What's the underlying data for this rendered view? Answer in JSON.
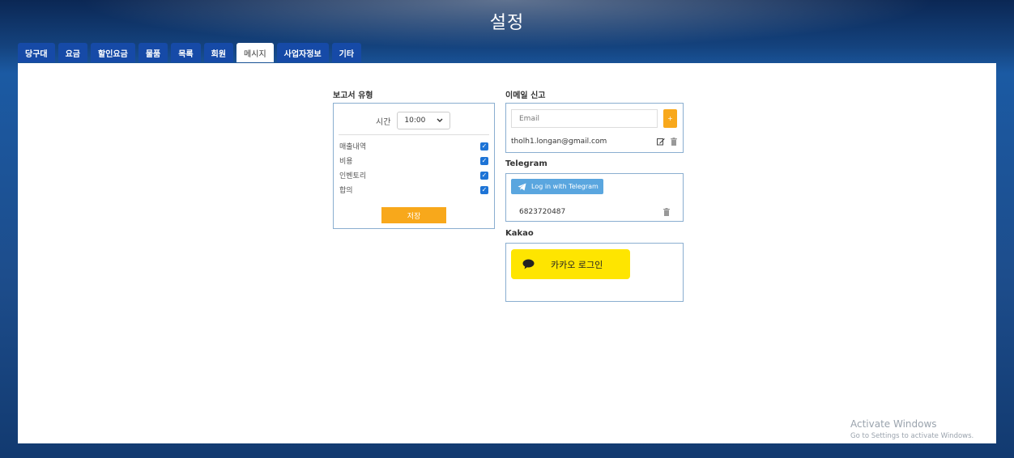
{
  "window": {
    "title": "설정"
  },
  "tabs": [
    {
      "label": "당구대",
      "active": false
    },
    {
      "label": "요금",
      "active": false
    },
    {
      "label": "할인요금",
      "active": false
    },
    {
      "label": "물품",
      "active": false
    },
    {
      "label": "목록",
      "active": false
    },
    {
      "label": "회원",
      "active": false
    },
    {
      "label": "메시지",
      "active": true
    },
    {
      "label": "사업자정보",
      "active": false
    },
    {
      "label": "기타",
      "active": false
    }
  ],
  "report": {
    "section_title": "보고서 유형",
    "time_label": "시간",
    "time_value": "10:00",
    "items": [
      {
        "label": "매출내역",
        "checked": true
      },
      {
        "label": "비용",
        "checked": true
      },
      {
        "label": "인벤토리",
        "checked": true
      },
      {
        "label": "합의",
        "checked": true
      }
    ],
    "save_label": "저장"
  },
  "email": {
    "section_title": "이메일 신고",
    "placeholder": "Email",
    "add_label": "+",
    "entries": [
      "tholh1.longan@gmail.com"
    ]
  },
  "telegram": {
    "section_title": "Telegram",
    "login_label": "Log in with Telegram",
    "chat_id": "6823720487"
  },
  "kakao": {
    "section_title": "Kakao",
    "login_label": "카카오 로그인"
  },
  "watermark": {
    "line1": "Activate Windows",
    "line2": "Go to Settings to activate Windows."
  },
  "colors": {
    "accent": "#f8a81b",
    "tab_bg": "#164aa7",
    "checkbox": "#1e74d6",
    "telegram": "#5aa6df",
    "kakao": "#fee500"
  }
}
